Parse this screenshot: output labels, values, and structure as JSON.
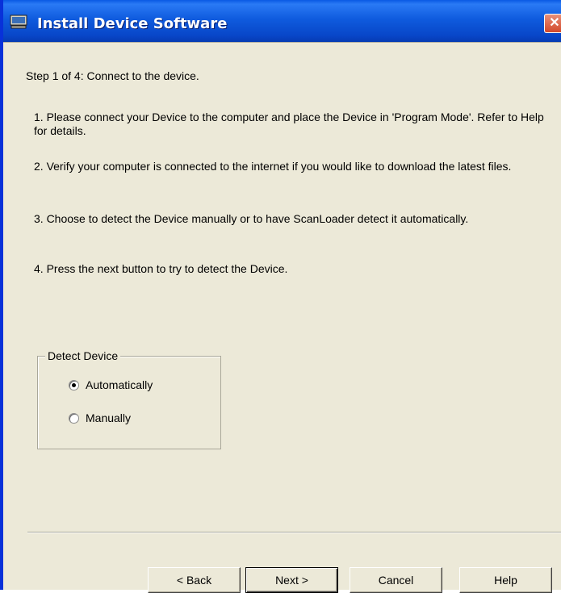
{
  "window": {
    "title": "Install Device Software",
    "close_glyph": "✕"
  },
  "content": {
    "step": "Step 1 of 4:  Connect to the device.",
    "instructions": [
      "1.  Please connect your Device to the computer and place the Device in 'Program Mode'.  Refer to Help for details.",
      "2.  Verify your computer is connected to the internet if you would like to download the latest files.",
      "3.  Choose to detect the Device manually or to have ScanLoader detect it automatically.",
      "4.  Press the next button to try to detect the Device."
    ]
  },
  "detect_group": {
    "label": "Detect Device",
    "options": [
      {
        "label": "Automatically",
        "checked": true
      },
      {
        "label": "Manually",
        "checked": false
      }
    ]
  },
  "buttons": {
    "back": "< Back",
    "next": "Next >",
    "cancel": "Cancel",
    "help": "Help"
  },
  "colors": {
    "titlebar": "#0f5bde",
    "face": "#ece9d8",
    "close": "#d3482a"
  },
  "icons": {
    "title_icon": "computer-icon",
    "close_icon": "close-icon"
  }
}
